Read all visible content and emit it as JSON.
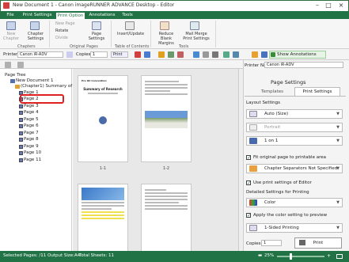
{
  "window": {
    "title": "New Document 1 - Canon imageRUNNER ADVANCE Desktop - Editor"
  },
  "ribbon_tabs": [
    "File",
    "Print Settings",
    "Print Option",
    "Annotations",
    "Tools"
  ],
  "ribbon": {
    "new_chapter": "New Chapter",
    "chapter_settings": "Chapter Settings",
    "group_chapters": "Chapters",
    "new_page": "New Page",
    "rotate": "Rotate",
    "divide": "Divide",
    "page_settings": "Page Settings",
    "group_original_pages": "Original Pages",
    "insert_update": "Insert/Update",
    "group_toc": "Table of Contents",
    "reduce_margins": "Reduce Blank Margins",
    "mail_merge": "Mail Merge Print Settings",
    "group_tools": "Tools"
  },
  "toolbar": {
    "printer_label": "Printer:",
    "printer_value": "Canon iR-ADV",
    "copies_label": "Copies:",
    "copies_value": "1",
    "print_label": "Print",
    "show_annotations": "Show Annotations"
  },
  "tree": {
    "header": "Page Tree",
    "root": "New Document 1",
    "chapter": "(Chapter1) Summary of",
    "pages": [
      "Page 1",
      "Page 2",
      "Page 3",
      "Page 4",
      "Page 5",
      "Page 6",
      "Page 7",
      "Page 8",
      "Page 9",
      "Page 10",
      "Page 11"
    ]
  },
  "pages": {
    "p1_heading": "Pre Oil Convention",
    "p1_title": "Summary of Research",
    "label_1_1": "1-1",
    "label_1_2": "1-2"
  },
  "right": {
    "printer_name_label": "Printer Name:",
    "printer_name_value": "Canon iR-ADV",
    "header": "Page Settings",
    "tab_templates": "Templates",
    "tab_print_settings": "Print Settings",
    "layout_settings": "Layout Settings",
    "auto_size": "Auto (Size)",
    "portrait": "Portrait",
    "one_on_one": "1 on 1",
    "fit_original": "Fit original page to printable area",
    "chapter_separators": "Chapter Separators Not Specified",
    "use_print_settings": "Use print settings of Editor",
    "detailed_settings": "Detailed Settings for Printing",
    "color": "Color",
    "apply_color": "Apply the color setting to preview",
    "one_sided": "1-Sided Printing",
    "copies_label": "Copies:",
    "copies_value": "1",
    "print_button": "Print"
  },
  "status": {
    "selected_pages": "Selected Pages: /11",
    "output_size": "Output Size:A4",
    "total_sheets": "Total Sheets: 11",
    "zoom": "25%"
  }
}
